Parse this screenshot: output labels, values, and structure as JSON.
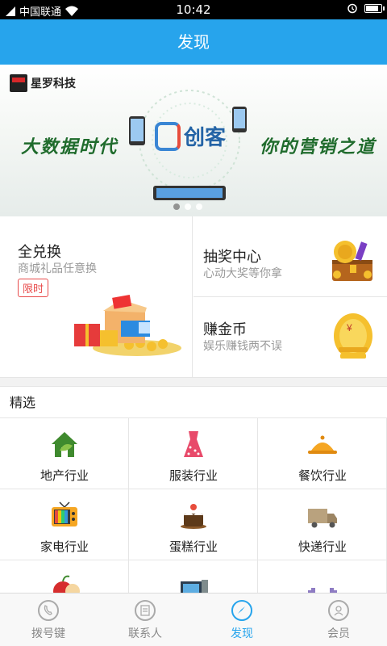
{
  "status_bar": {
    "carrier": "中国联通",
    "time": "10:42",
    "battery_level": 0.9
  },
  "header": {
    "title": "发现"
  },
  "banner": {
    "company": "星罗科技",
    "brand": "创客",
    "slogan_left": "大数据时代",
    "slogan_right": "你的营销之道"
  },
  "promo": {
    "exchange": {
      "title": "全兑换",
      "subtitle": "商城礼品任意换",
      "badge": "限时"
    },
    "lottery": {
      "title": "抽奖中心",
      "subtitle": "心动大奖等你拿"
    },
    "coins": {
      "title": "赚金币",
      "subtitle": "娱乐赚钱两不误"
    }
  },
  "featured": {
    "title": "精选",
    "items": [
      {
        "label": "地产行业",
        "icon": "house-icon"
      },
      {
        "label": "服装行业",
        "icon": "dress-icon"
      },
      {
        "label": "餐饮行业",
        "icon": "food-cloche-icon"
      },
      {
        "label": "家电行业",
        "icon": "tv-icon"
      },
      {
        "label": "蛋糕行业",
        "icon": "cake-icon"
      },
      {
        "label": "快递行业",
        "icon": "truck-icon"
      },
      {
        "label": "",
        "icon": "apple-icon"
      },
      {
        "label": "",
        "icon": "computer-icon"
      },
      {
        "label": "",
        "icon": "dumbbell-icon"
      }
    ]
  },
  "bottom_nav": {
    "items": [
      {
        "label": "拨号键",
        "icon": "phone-dial-icon"
      },
      {
        "label": "联系人",
        "icon": "contacts-icon"
      },
      {
        "label": "发现",
        "icon": "compass-icon",
        "active": true
      },
      {
        "label": "会员",
        "icon": "member-icon"
      }
    ]
  },
  "colors": {
    "accent": "#27a4ec",
    "badge": "#e84a4a"
  }
}
